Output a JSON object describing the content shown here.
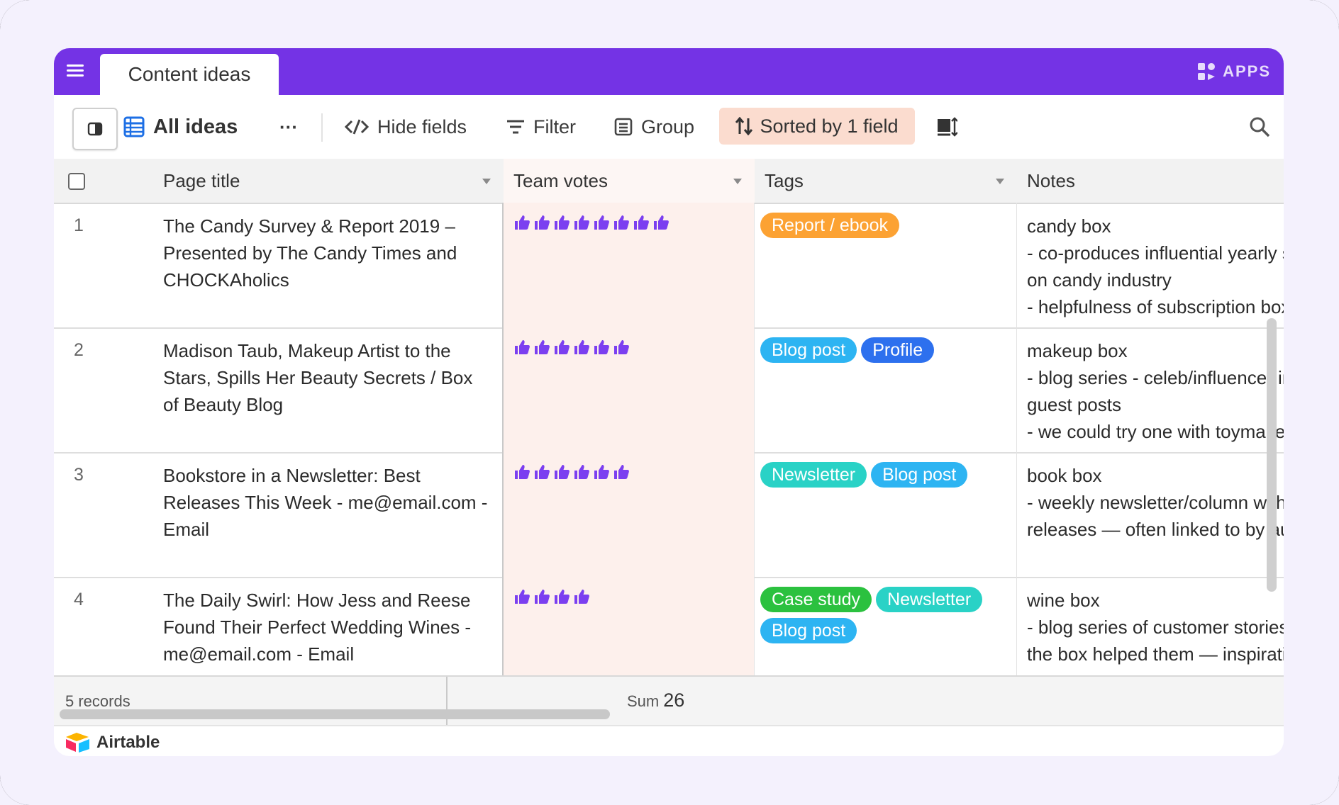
{
  "app": {
    "tab_title": "Content ideas",
    "apps_label": "APPS",
    "brand": "Airtable"
  },
  "toolbar": {
    "view_name": "All ideas",
    "more": "···",
    "hide_fields": "Hide fields",
    "filter": "Filter",
    "group": "Group",
    "sort": "Sorted by 1 field"
  },
  "columns": {
    "title": "Page title",
    "votes": "Team votes",
    "tags": "Tags",
    "notes": "Notes"
  },
  "rows": [
    {
      "num": "1",
      "title": "The Candy Survey & Report 2019 – Presented by The Candy Times and CHOCKAholics",
      "votes": 8,
      "tags": [
        {
          "label": "Report / ebook",
          "color": "#fca233"
        }
      ],
      "notes": [
        "candy box",
        "- co-produces influential yearly survey",
        "on candy industry",
        "- helpfulness of subscription box services"
      ]
    },
    {
      "num": "2",
      "title": "Madison Taub, Makeup Artist to the Stars, Spills Her Beauty Secrets / Box of Beauty Blog",
      "votes": 6,
      "tags": [
        {
          "label": "Blog post",
          "color": "#2db4f2"
        },
        {
          "label": "Profile",
          "color": "#2d70ee"
        }
      ],
      "notes": [
        "makeup box",
        "- blog series - celeb/influencer interviews",
        "guest posts",
        "- we could try one with toymakers?"
      ]
    },
    {
      "num": "3",
      "title": "Bookstore in a Newsletter: Best Releases This Week - me@email.com - Email",
      "votes": 6,
      "tags": [
        {
          "label": "Newsletter",
          "color": "#29d2c6"
        },
        {
          "label": "Blog post",
          "color": "#2db4f2"
        }
      ],
      "notes": [
        "book box",
        "- weekly newsletter/column with lists of",
        "releases — often linked to by authors"
      ]
    },
    {
      "num": "4",
      "title": "The Daily Swirl: How Jess and Reese Found Their Perfect Wedding Wines - me@email.com - Email",
      "votes": 4,
      "tags": [
        {
          "label": "Case study",
          "color": "#2bc13f"
        },
        {
          "label": "Newsletter",
          "color": "#29d2c6"
        },
        {
          "label": "Blog post",
          "color": "#2db4f2"
        }
      ],
      "notes": [
        "wine box",
        "- blog series of customer stories about",
        "the box helped them — inspiration, p"
      ]
    }
  ],
  "footer": {
    "records": "5 records",
    "sum_label": "Sum",
    "sum_value": "26"
  },
  "colors": {
    "accent": "#7433e5",
    "vote_thumb": "#7b3ff0",
    "sort_bg": "#fbdccf",
    "votes_bg": "#fdf0ec"
  }
}
